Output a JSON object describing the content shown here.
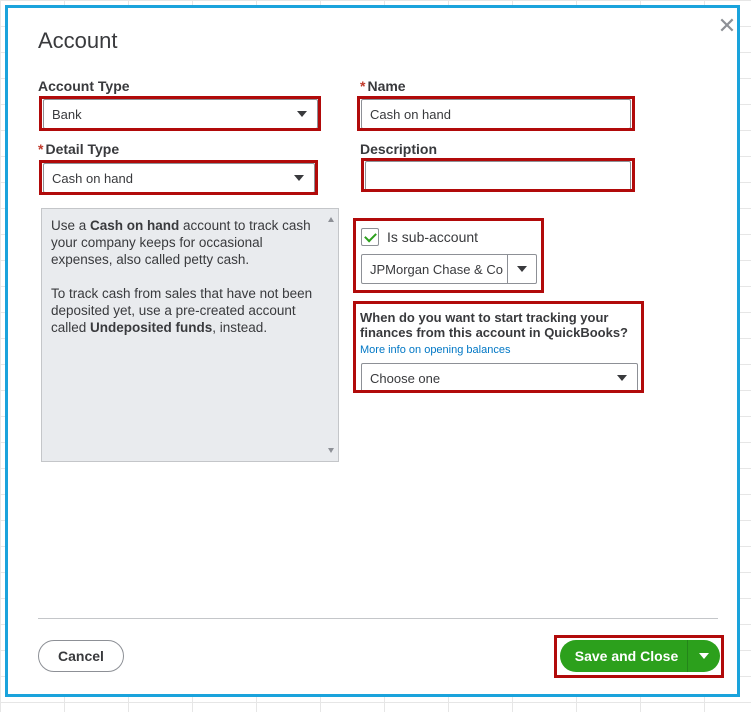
{
  "dialog": {
    "title": "Account",
    "close_icon": "close-icon"
  },
  "form": {
    "account_type": {
      "label": "Account Type",
      "value": "Bank"
    },
    "name": {
      "label": "Name",
      "required_marker": "*",
      "value": "Cash on hand"
    },
    "detail_type": {
      "label": "Detail Type",
      "required_marker": "*",
      "value": "Cash on hand"
    },
    "description": {
      "label": "Description",
      "value": ""
    },
    "help": {
      "p1_pre": "Use a ",
      "p1_bold": "Cash on hand",
      "p1_post": " account to track cash your company keeps for occasional expenses, also called petty cash.",
      "p2_pre": "To track cash from sales that have not been deposited yet, use a pre-created account called ",
      "p2_bold": "Undeposited funds",
      "p2_post": ", instead."
    },
    "sub_account": {
      "label": "Is sub-account",
      "checked": true,
      "parent_value": "JPMorgan Chase & Co"
    },
    "tracking": {
      "question": "When do you want to start tracking your finances from this account in QuickBooks?",
      "link": "More info on opening balances",
      "value": "Choose one"
    }
  },
  "footer": {
    "cancel_label": "Cancel",
    "save_label": "Save and Close"
  },
  "colors": {
    "accent_border": "#1aa3dc",
    "highlight": "#b10a0a",
    "save_green": "#2ca01c",
    "required_red": "#c0392b",
    "link_blue": "#0077c5"
  }
}
